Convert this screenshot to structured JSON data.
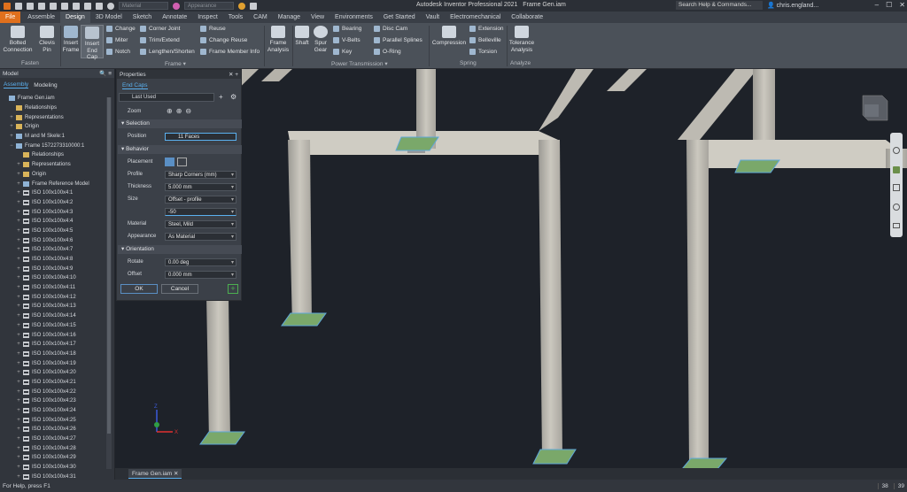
{
  "app": {
    "title": "Autodesk Inventor Professional 2021",
    "document": "Frame Gen.iam"
  },
  "quickaccess": {
    "material": "Material",
    "appearance": "Appearance"
  },
  "search": {
    "placeholder": "Search Help & Commands..."
  },
  "user": {
    "name": "chris.england..."
  },
  "tabs": [
    {
      "label": "File"
    },
    {
      "label": "Assemble"
    },
    {
      "label": "Design"
    },
    {
      "label": "3D Model"
    },
    {
      "label": "Sketch"
    },
    {
      "label": "Annotate"
    },
    {
      "label": "Inspect"
    },
    {
      "label": "Tools"
    },
    {
      "label": "CAM"
    },
    {
      "label": "Manage"
    },
    {
      "label": "View"
    },
    {
      "label": "Environments"
    },
    {
      "label": "Get Started"
    },
    {
      "label": "Vault"
    },
    {
      "label": "Electromechanical"
    },
    {
      "label": "Collaborate"
    }
  ],
  "ribbon": {
    "bolted": "Bolted\nConnection",
    "clevis": "Clevis\nPin",
    "insert_frame": "Insert\nFrame",
    "insert_endcap": "Insert\nEnd Cap",
    "change": "Change",
    "miter": "Miter",
    "notch": "Notch",
    "corner_joint": "Corner Joint",
    "trim_extend": "Trim/Extend",
    "lengthen": "Lengthen/Shorten",
    "reuse": "Reuse",
    "change_reuse": "Change Reuse",
    "frame_member_info": "Frame Member Info",
    "frame_analysis": "Frame\nAnalysis",
    "shaft": "Shaft",
    "spur_gear": "Spur\nGear",
    "bearing": "Bearing",
    "vbelts": "V-Belts",
    "key": "Key",
    "disc_cam": "Disc Cam",
    "parallel_splines": "Parallel Splines",
    "oring": "O-Ring",
    "compression": "Compression",
    "extension": "Extension",
    "belleville": "Belleville",
    "torsion": "Torsion",
    "tolerance": "Tolerance\nAnalysis",
    "groups": {
      "fasten": "Fasten",
      "frame": "Frame ▾",
      "power": "Power Transmission ▾",
      "spring": "Spring",
      "analyze": "Analyze"
    }
  },
  "browser": {
    "title": "Model",
    "tab_assembly": "Assembly",
    "tab_modeling": "Modeling",
    "items": [
      {
        "label": "Frame Gen.iam",
        "icon": "assembly-icon",
        "indent": 0,
        "ex": ""
      },
      {
        "label": "Relationships",
        "icon": "folder-icon",
        "indent": 1,
        "ex": ""
      },
      {
        "label": "Representations",
        "icon": "folder-icon",
        "indent": 1,
        "ex": "+"
      },
      {
        "label": "Origin",
        "icon": "folder-icon",
        "indent": 1,
        "ex": "+"
      },
      {
        "label": "M and M Skele:1",
        "icon": "part-icon",
        "indent": 1,
        "ex": "+"
      },
      {
        "label": "Frame 1572273310000:1",
        "icon": "assembly-icon",
        "indent": 1,
        "ex": "−"
      },
      {
        "label": "Relationships",
        "icon": "folder-icon",
        "indent": 2,
        "ex": ""
      },
      {
        "label": "Representations",
        "icon": "folder-icon",
        "indent": 2,
        "ex": "+"
      },
      {
        "label": "Origin",
        "icon": "folder-icon",
        "indent": 2,
        "ex": "+"
      },
      {
        "label": "Frame Reference Model",
        "icon": "part-icon",
        "indent": 2,
        "ex": "+"
      },
      {
        "label": "ISO 100x100x4:1",
        "icon": "beam-icon",
        "indent": 2,
        "ex": "+"
      },
      {
        "label": "ISO 100x100x4:2",
        "icon": "beam-icon",
        "indent": 2,
        "ex": "+"
      },
      {
        "label": "ISO 100x100x4:3",
        "icon": "beam-icon",
        "indent": 2,
        "ex": "+"
      },
      {
        "label": "ISO 100x100x4:4",
        "icon": "beam-icon",
        "indent": 2,
        "ex": "+"
      },
      {
        "label": "ISO 100x100x4:5",
        "icon": "beam-icon",
        "indent": 2,
        "ex": "+"
      },
      {
        "label": "ISO 100x100x4:6",
        "icon": "beam-icon",
        "indent": 2,
        "ex": "+"
      },
      {
        "label": "ISO 100x100x4:7",
        "icon": "beam-icon",
        "indent": 2,
        "ex": "+"
      },
      {
        "label": "ISO 100x100x4:8",
        "icon": "beam-icon",
        "indent": 2,
        "ex": "+"
      },
      {
        "label": "ISO 100x100x4:9",
        "icon": "beam-icon",
        "indent": 2,
        "ex": "+"
      },
      {
        "label": "ISO 100x100x4:10",
        "icon": "beam-icon",
        "indent": 2,
        "ex": "+"
      },
      {
        "label": "ISO 100x100x4:11",
        "icon": "beam-icon",
        "indent": 2,
        "ex": "+"
      },
      {
        "label": "ISO 100x100x4:12",
        "icon": "beam-icon",
        "indent": 2,
        "ex": "+"
      },
      {
        "label": "ISO 100x100x4:13",
        "icon": "beam-icon",
        "indent": 2,
        "ex": "+"
      },
      {
        "label": "ISO 100x100x4:14",
        "icon": "beam-icon",
        "indent": 2,
        "ex": "+"
      },
      {
        "label": "ISO 100x100x4:15",
        "icon": "beam-icon",
        "indent": 2,
        "ex": "+"
      },
      {
        "label": "ISO 100x100x4:16",
        "icon": "beam-icon",
        "indent": 2,
        "ex": "+"
      },
      {
        "label": "ISO 100x100x4:17",
        "icon": "beam-icon",
        "indent": 2,
        "ex": "+"
      },
      {
        "label": "ISO 100x100x4:18",
        "icon": "beam-icon",
        "indent": 2,
        "ex": "+"
      },
      {
        "label": "ISO 100x100x4:19",
        "icon": "beam-icon",
        "indent": 2,
        "ex": "+"
      },
      {
        "label": "ISO 100x100x4:20",
        "icon": "beam-icon",
        "indent": 2,
        "ex": "+"
      },
      {
        "label": "ISO 100x100x4:21",
        "icon": "beam-icon",
        "indent": 2,
        "ex": "+"
      },
      {
        "label": "ISO 100x100x4:22",
        "icon": "beam-icon",
        "indent": 2,
        "ex": "+"
      },
      {
        "label": "ISO 100x100x4:23",
        "icon": "beam-icon",
        "indent": 2,
        "ex": "+"
      },
      {
        "label": "ISO 100x100x4:24",
        "icon": "beam-icon",
        "indent": 2,
        "ex": "+"
      },
      {
        "label": "ISO 100x100x4:25",
        "icon": "beam-icon",
        "indent": 2,
        "ex": "+"
      },
      {
        "label": "ISO 100x100x4:26",
        "icon": "beam-icon",
        "indent": 2,
        "ex": "+"
      },
      {
        "label": "ISO 100x100x4:27",
        "icon": "beam-icon",
        "indent": 2,
        "ex": "+"
      },
      {
        "label": "ISO 100x100x4:28",
        "icon": "beam-icon",
        "indent": 2,
        "ex": "+"
      },
      {
        "label": "ISO 100x100x4:29",
        "icon": "beam-icon",
        "indent": 2,
        "ex": "+"
      },
      {
        "label": "ISO 100x100x4:30",
        "icon": "beam-icon",
        "indent": 2,
        "ex": "+"
      },
      {
        "label": "ISO 100x100x4:31",
        "icon": "beam-icon",
        "indent": 2,
        "ex": "+"
      }
    ]
  },
  "properties": {
    "title": "Properties",
    "tab": "End Caps",
    "preset": "Last Used",
    "zoom": "Zoom",
    "sec_selection": "Selection",
    "position_label": "Position",
    "position_value": "11 Faces",
    "sec_behavior": "Behavior",
    "placement_label": "Placement",
    "profile_label": "Profile",
    "profile_value": "Sharp Corners (mm)",
    "thickness_label": "Thickness",
    "thickness_value": "5.000 mm",
    "size_label": "Size",
    "size_value": "Offset - profile",
    "size_offset": "-50",
    "material_label": "Material",
    "material_value": "Steel, Mild",
    "appearance_label": "Appearance",
    "appearance_value": "As Material",
    "sec_orientation": "Orientation",
    "rotate_label": "Rotate",
    "rotate_value": "0.00 deg",
    "offset_label": "Offset",
    "offset_value": "0.000 mm",
    "ok": "OK",
    "cancel": "Cancel"
  },
  "doc_tab": "Frame Gen.iam",
  "status": {
    "help": "For Help, press F1",
    "n1": "38",
    "n2": "39"
  },
  "colors": {
    "file_tab": "#e0701d",
    "accent": "#5ab0ef",
    "beam": "#c9c6bd",
    "endcap": "#7aa86a"
  }
}
